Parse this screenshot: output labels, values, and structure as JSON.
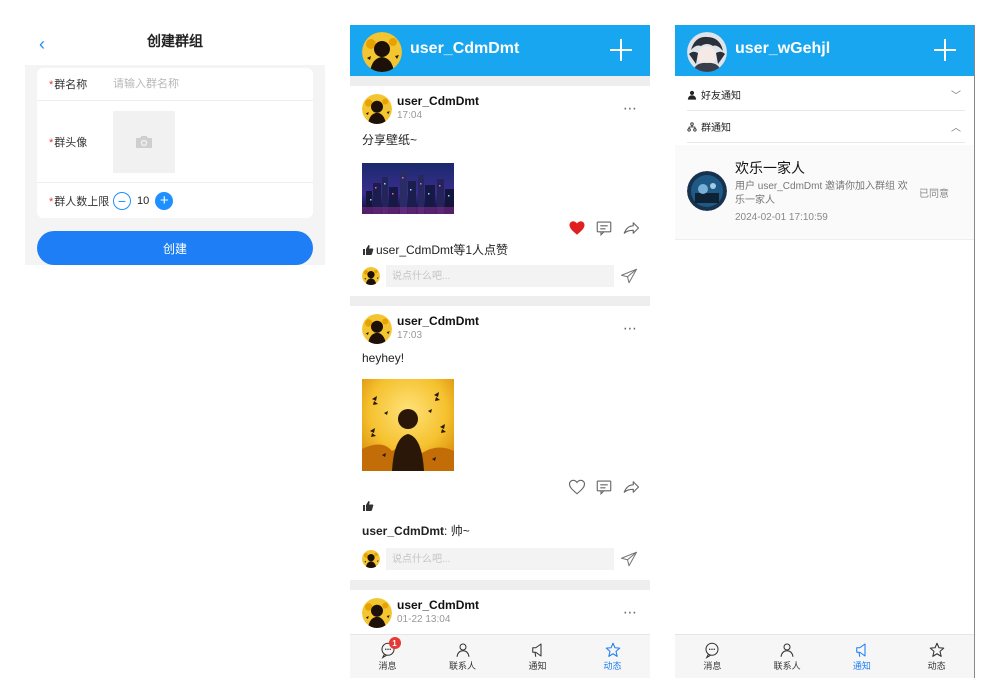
{
  "create_group": {
    "back_icon": "chevron-left-icon",
    "title": "创建群组",
    "name_label": "群名称",
    "name_placeholder": "请输入群名称",
    "avatar_label": "群头像",
    "avatar_icon": "camera-icon",
    "limit_label": "群人数上限",
    "limit_value": "10",
    "required_mark": "*",
    "create_button": "创建"
  },
  "feed": {
    "header": {
      "username": "user_CdmDmt",
      "add_icon": "plus-icon"
    },
    "posts": [
      {
        "user": "user_CdmDmt",
        "time": "17:04",
        "text": "分享壁纸~",
        "image": "city-night-wallpaper",
        "liked": true,
        "likes_text": "user_CdmDmt等1人点赞",
        "comment_placeholder": "说点什么吧..."
      },
      {
        "user": "user_CdmDmt",
        "time": "17:03",
        "text": "heyhey!",
        "image": "yellow-butterfly-wallpaper",
        "liked": false,
        "likes_text": "",
        "comment_user": "user_CdmDmt",
        "comment_text": ": 帅~",
        "comment_placeholder": "说点什么吧..."
      },
      {
        "user": "user_CdmDmt",
        "time": "01-22 13:04"
      }
    ],
    "tabs": [
      {
        "label": "消息",
        "icon": "message-icon",
        "badge": "1"
      },
      {
        "label": "联系人",
        "icon": "contacts-icon"
      },
      {
        "label": "通知",
        "icon": "notice-icon"
      },
      {
        "label": "动态",
        "icon": "star-icon",
        "active": true
      }
    ]
  },
  "notices": {
    "header": {
      "username": "user_wGehjl",
      "add_icon": "plus-icon"
    },
    "friend_section": "好友通知",
    "group_section": "群通知",
    "items": [
      {
        "title": "欢乐一家人",
        "message": "用户 user_CdmDmt 邀请你加入群组 欢乐一家人",
        "time": "2024-02-01 17:10:59",
        "status": "已同意"
      }
    ],
    "tabs": [
      {
        "label": "消息",
        "icon": "message-icon"
      },
      {
        "label": "联系人",
        "icon": "contacts-icon"
      },
      {
        "label": "通知",
        "icon": "notice-icon",
        "active": true
      },
      {
        "label": "动态",
        "icon": "star-icon"
      }
    ]
  },
  "colors": {
    "brand_blue": "#18a6f0",
    "button_blue": "#1e7ef5",
    "like_red": "#e02020",
    "badge_red": "#e53935"
  }
}
